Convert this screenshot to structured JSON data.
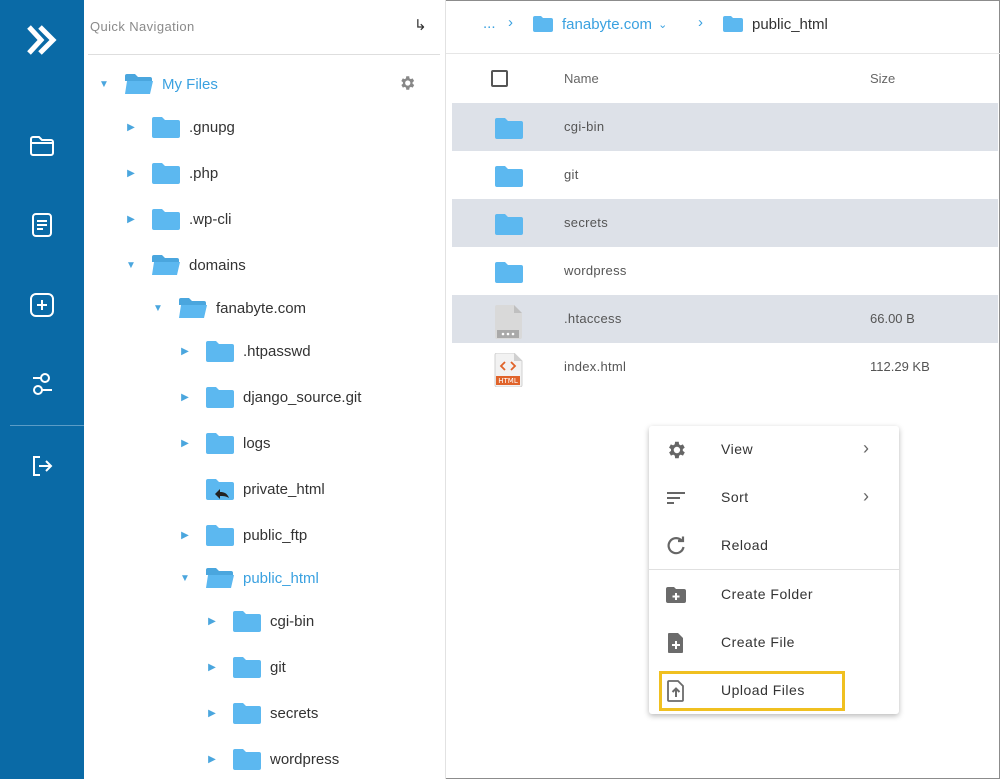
{
  "rail": {
    "bg_color": "#0a6aa6",
    "icons": [
      "logo-icon",
      "folder-icon",
      "document-icon",
      "plus-square-icon",
      "settings-sliders-icon",
      "logout-icon"
    ]
  },
  "tree": {
    "header": "Quick Navigation",
    "root": "My Files",
    "nodes": [
      {
        "label": ".gnupg"
      },
      {
        "label": ".php"
      },
      {
        "label": ".wp-cli"
      },
      {
        "label": "domains"
      },
      {
        "label": "fanabyte.com"
      },
      {
        "label": ".htpasswd"
      },
      {
        "label": "django_source.git"
      },
      {
        "label": "logs"
      },
      {
        "label": "private_html"
      },
      {
        "label": "public_ftp"
      },
      {
        "label": "public_html"
      },
      {
        "label": "cgi-bin"
      },
      {
        "label": "git"
      },
      {
        "label": "secrets"
      },
      {
        "label": "wordpress"
      }
    ]
  },
  "breadcrumb": {
    "ellipsis": "...",
    "domain": "fanabyte.com",
    "current": "public_html"
  },
  "table": {
    "col_name": "Name",
    "col_size": "Size",
    "rows": [
      {
        "name": "cgi-bin",
        "size": ""
      },
      {
        "name": "git",
        "size": ""
      },
      {
        "name": "secrets",
        "size": ""
      },
      {
        "name": "wordpress",
        "size": ""
      },
      {
        "name": ".htaccess",
        "size": "66.00 B"
      },
      {
        "name": "index.html",
        "size": "112.29 KB"
      }
    ]
  },
  "menu": {
    "items": [
      {
        "label": "View",
        "icon": "gear-icon"
      },
      {
        "label": "Sort",
        "icon": "sort-icon"
      },
      {
        "label": "Reload",
        "icon": "reload-icon"
      },
      {
        "label": "Create Folder",
        "icon": "folder-plus-icon"
      },
      {
        "label": "Create File",
        "icon": "file-plus-icon"
      },
      {
        "label": "Upload Files",
        "icon": "upload-file-icon"
      }
    ],
    "highlight_color": "#f0c020"
  },
  "colors": {
    "accent": "#3aa1e0",
    "folder": "#5cb8f0",
    "row_shade": "#dde1e8"
  }
}
